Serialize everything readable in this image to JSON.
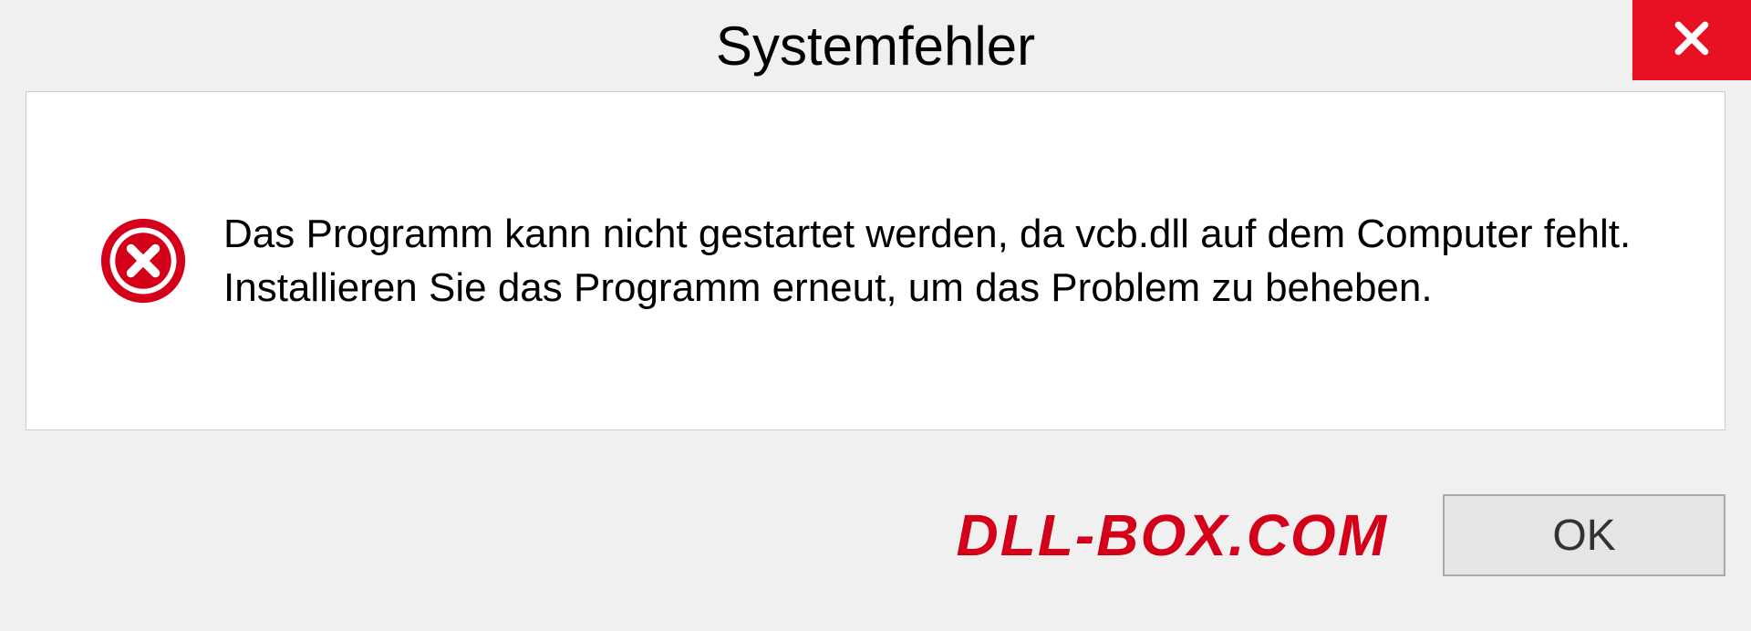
{
  "dialog": {
    "title": "Systemfehler",
    "message": "Das Programm kann nicht gestartet werden, da vcb.dll auf dem Computer fehlt. Installieren Sie das Programm erneut, um das Problem zu beheben.",
    "ok_label": "OK"
  },
  "watermark": "DLL-BOX.COM"
}
